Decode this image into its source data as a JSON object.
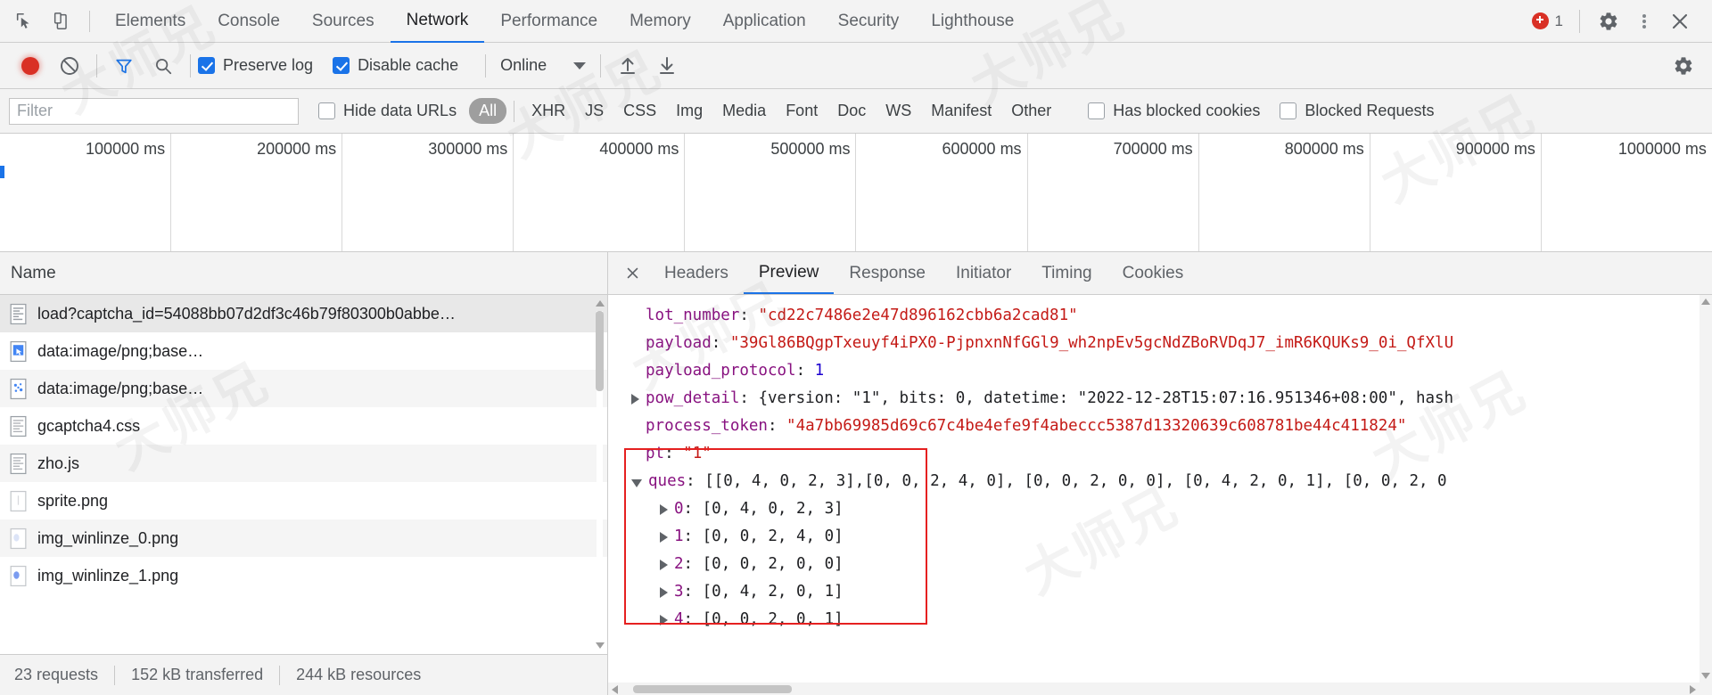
{
  "window": {
    "tabs": [
      {
        "label": "Elements",
        "active": false
      },
      {
        "label": "Console",
        "active": false
      },
      {
        "label": "Sources",
        "active": false
      },
      {
        "label": "Network",
        "active": true
      },
      {
        "label": "Performance",
        "active": false
      },
      {
        "label": "Memory",
        "active": false
      },
      {
        "label": "Application",
        "active": false
      },
      {
        "label": "Security",
        "active": false
      },
      {
        "label": "Lighthouse",
        "active": false
      }
    ],
    "error_count": "1",
    "icons": {
      "inspect": "inspect-element-icon",
      "device": "device-toolbar-icon",
      "settings": "gear-icon",
      "more": "kebab-menu-icon",
      "close": "close-icon"
    }
  },
  "network_toolbar": {
    "record_title": "record-button",
    "clear_title": "clear-button",
    "filter_title": "filter-funnel-icon",
    "search_title": "search-icon",
    "preserve_log": {
      "label": "Preserve log",
      "checked": true
    },
    "disable_cache": {
      "label": "Disable cache",
      "checked": true
    },
    "throttle_value": "Online",
    "import_title": "import-har-icon",
    "export_title": "export-har-icon",
    "settings_title": "gear-icon"
  },
  "filter_bar": {
    "filter_placeholder": "Filter",
    "filter_value": "",
    "hide_data_urls": {
      "label": "Hide data URLs",
      "checked": false
    },
    "types": [
      {
        "label": "All",
        "active": true
      },
      {
        "label": "XHR",
        "active": false
      },
      {
        "label": "JS",
        "active": false
      },
      {
        "label": "CSS",
        "active": false
      },
      {
        "label": "Img",
        "active": false
      },
      {
        "label": "Media",
        "active": false
      },
      {
        "label": "Font",
        "active": false
      },
      {
        "label": "Doc",
        "active": false
      },
      {
        "label": "WS",
        "active": false
      },
      {
        "label": "Manifest",
        "active": false
      },
      {
        "label": "Other",
        "active": false
      }
    ],
    "has_blocked_cookies": {
      "label": "Has blocked cookies",
      "checked": false
    },
    "blocked_requests": {
      "label": "Blocked Requests",
      "checked": false
    }
  },
  "overview": {
    "ticks": [
      "100000 ms",
      "200000 ms",
      "300000 ms",
      "400000 ms",
      "500000 ms",
      "600000 ms",
      "700000 ms",
      "800000 ms",
      "900000 ms",
      "1000000 ms"
    ]
  },
  "requests_panel": {
    "column_header": "Name",
    "rows": [
      {
        "name": "load?captcha_id=54088bb07d2df3c46b79f80300b0abbe…",
        "icon": "document-icon",
        "selected": true
      },
      {
        "name": "data:image/png;base…",
        "icon": "image-icon",
        "selected": false
      },
      {
        "name": "data:image/png;base…",
        "icon": "image-icon",
        "selected": false
      },
      {
        "name": "gcaptcha4.css",
        "icon": "stylesheet-icon",
        "selected": false
      },
      {
        "name": "zho.js",
        "icon": "script-icon",
        "selected": false
      },
      {
        "name": "sprite.png",
        "icon": "image-icon",
        "selected": false
      },
      {
        "name": "img_winlinze_0.png",
        "icon": "image-icon",
        "selected": false
      },
      {
        "name": "img_winlinze_1.png",
        "icon": "image-icon",
        "selected": false
      }
    ],
    "status": {
      "requests": "23 requests",
      "transferred": "152 kB transferred",
      "resources": "244 kB resources"
    }
  },
  "detail_panel": {
    "tabs": [
      {
        "label": "Headers",
        "active": false
      },
      {
        "label": "Preview",
        "active": true
      },
      {
        "label": "Response",
        "active": false
      },
      {
        "label": "Initiator",
        "active": false
      },
      {
        "label": "Timing",
        "active": false
      },
      {
        "label": "Cookies",
        "active": false
      }
    ],
    "preview": {
      "lot_number_key": "lot_number",
      "lot_number_value": "\"cd22c7486e2e47d896162cbb6a2cad81\"",
      "payload_key": "payload",
      "payload_value": "\"39Gl86BQgpTxeuyf4iPX0-PjpnxnNfGGl9_wh2npEv5gcNdZBoRVDqJ7_imR6KQUKs9_0i_QfXlU",
      "payload_protocol_key": "payload_protocol",
      "payload_protocol_value": "1",
      "pow_detail_key": "pow_detail",
      "pow_detail_value": "{version: \"1\", bits: 0, datetime: \"2022-12-28T15:07:16.951346+08:00\", hash",
      "process_token_key": "process_token",
      "process_token_value": "\"4a7bb69985d69c67c4be4efe9f4abeccc5387d13320639c608781be44c411824\"",
      "pt_key": "pt",
      "pt_value": "\"1\"",
      "ques_key": "ques",
      "ques_value": "[[0, 4, 0, 2, 3], [0, 0, 2, 4, 0], [0, 0, 2, 0, 0], [0, 4, 2, 0, 1], [0, 0, 2, 0",
      "ques_first": "[[0, 4, 0, 2, 3],",
      "ques_rest": " [0, 0, 2, 4, 0], [0, 0, 2, 0, 0], [0, 4, 2, 0, 1], [0, 0, 2, 0",
      "ques_children": [
        {
          "index": "0",
          "value": "[0, 4, 0, 2, 3]"
        },
        {
          "index": "1",
          "value": "[0, 0, 2, 4, 0]"
        },
        {
          "index": "2",
          "value": "[0, 0, 2, 0, 0]"
        },
        {
          "index": "3",
          "value": "[0, 4, 2, 0, 1]"
        },
        {
          "index": "4",
          "value": "[0, 0, 2, 0, 1]"
        }
      ]
    }
  },
  "colors": {
    "accent": "#1a73e8",
    "error": "#d93025",
    "highlight_box": "#e52020",
    "key": "#881280",
    "string": "#c41a16",
    "number": "#1c00cf"
  },
  "watermarks": [
    "大师兄",
    "大师兄",
    "大师兄",
    "大师兄",
    "大师兄",
    "大师兄",
    "大师兄",
    "大师兄"
  ]
}
